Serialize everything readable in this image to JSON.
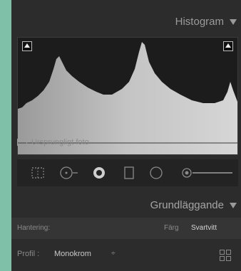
{
  "histogram": {
    "title": "Histogram",
    "original_photo_label": "Ursprungligt foto"
  },
  "tools": [
    {
      "icon": "crop-icon"
    },
    {
      "icon": "spot-removal-icon"
    },
    {
      "icon": "red-eye-icon"
    },
    {
      "icon": "graduated-filter-icon"
    },
    {
      "icon": "radial-filter-icon"
    },
    {
      "icon": "adjustment-brush-icon"
    }
  ],
  "basic": {
    "title": "Grundläggande",
    "treatment_label": "Hantering:",
    "treatment_color": "Färg",
    "treatment_bw": "Svartvitt",
    "profile_label": "Profil :",
    "profile_value": "Monokrom",
    "profile_arrow": "÷"
  },
  "colors": {
    "panel": "#2c2c2c",
    "desktop": "#7fc1a8",
    "histogram_fill": "#bdbdbd"
  }
}
